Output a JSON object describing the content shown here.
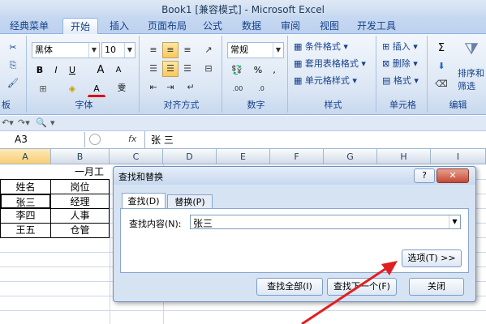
{
  "window": {
    "title": "Book1 [兼容模式] - Microsoft Excel"
  },
  "tabs": [
    "经典菜单",
    "开始",
    "插入",
    "页面布局",
    "公式",
    "数据",
    "审阅",
    "视图",
    "开发工具"
  ],
  "active_tab": "开始",
  "ribbon": {
    "clipboard_label": "板",
    "font": {
      "name": "黑体",
      "size": "10",
      "label": "字体",
      "bold": "B",
      "italic": "I",
      "underline": "U",
      "grow": "A",
      "shrink": "A",
      "color_a": "A",
      "wen": "雯"
    },
    "alignment": {
      "label": "对齐方式"
    },
    "number": {
      "format": "常规",
      "label": "数字",
      "percent": "%",
      "comma": ","
    },
    "styles": {
      "label": "样式",
      "conditional": "条件格式",
      "table": "套用表格格式",
      "cell": "单元格样式"
    },
    "cells": {
      "label": "单元格",
      "insert": "插入",
      "delete": "删除",
      "format": "格式"
    },
    "editing": {
      "label": "编辑",
      "sort": "排序和",
      "filter": "筛选",
      "sigma": "Σ"
    }
  },
  "formula_bar": {
    "namebox": "A3",
    "fx": "fx",
    "content": "张 三"
  },
  "columns": [
    "A",
    "B",
    "C",
    "D",
    "E",
    "F",
    "G",
    "H",
    "I"
  ],
  "sheet": {
    "title_cell": "一月工",
    "headers": [
      "姓名",
      "岗位"
    ],
    "rows": [
      [
        "张三",
        "经理"
      ],
      [
        "李四",
        "人事"
      ],
      [
        "王五",
        "仓管"
      ]
    ]
  },
  "dialog": {
    "title": "查找和替换",
    "help": "?",
    "close": "✕",
    "tab_find": "查找(D)",
    "tab_replace": "替换(P)",
    "find_label": "查找内容(N):",
    "find_value": "张三",
    "options": "选项(T) >>",
    "find_all": "查找全部(I)",
    "find_next": "查找下一个(F)",
    "close_btn": "关闭"
  }
}
